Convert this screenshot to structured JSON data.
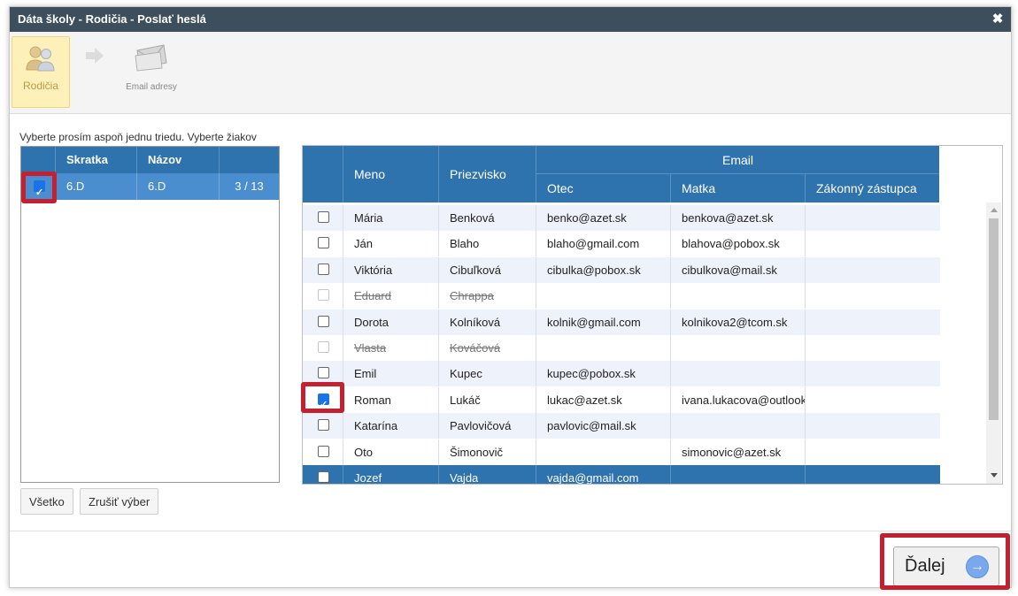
{
  "window": {
    "title": "Dáta školy - Rodičia - Poslať heslá",
    "close_symbol": "✖"
  },
  "wizard": {
    "steps": [
      {
        "label": "Rodičia",
        "icon": "parents-icon",
        "active": true
      },
      {
        "label": "Email adresy",
        "icon": "envelope-icon",
        "active": false
      }
    ],
    "arrow_icon": "arrow-right-icon"
  },
  "instruction": "Vyberte prosím aspoň jednu triedu. Vyberte žiakov",
  "class_grid": {
    "headers": {
      "shortcut": "Skratka",
      "name": "Názov"
    },
    "rows": [
      {
        "checked": true,
        "shortcut": "6.D",
        "name": "6.D",
        "count": "3 / 13"
      }
    ]
  },
  "student_grid": {
    "headers": {
      "first": "Meno",
      "last": "Priezvisko",
      "email_group": "Email",
      "father": "Otec",
      "mother": "Matka",
      "guardian": "Zákonný zástupca"
    },
    "rows": [
      {
        "first": "Mária",
        "last": "Benková",
        "father": "benko@azet.sk",
        "mother": "benkova@azet.sk",
        "guardian": "",
        "checked": false,
        "disabled": false
      },
      {
        "first": "Ján",
        "last": "Blaho",
        "father": "blaho@gmail.com",
        "mother": "blahova@pobox.sk",
        "guardian": "",
        "checked": false,
        "disabled": false
      },
      {
        "first": "Viktória",
        "last": "Cibuľková",
        "father": "cibulka@pobox.sk",
        "mother": "cibulkova@mail.sk",
        "guardian": "",
        "checked": false,
        "disabled": false
      },
      {
        "first": "Eduard",
        "last": "Chrappa",
        "father": "",
        "mother": "",
        "guardian": "",
        "checked": false,
        "disabled": true
      },
      {
        "first": "Dorota",
        "last": "Kolníková",
        "father": "kolnik@gmail.com",
        "mother": "kolnikova2@tcom.sk",
        "guardian": "",
        "checked": false,
        "disabled": false
      },
      {
        "first": "Vlasta",
        "last": "Kováčová",
        "father": "",
        "mother": "",
        "guardian": "",
        "checked": false,
        "disabled": true
      },
      {
        "first": "Emil",
        "last": "Kupec",
        "father": "kupec@pobox.sk",
        "mother": "",
        "guardian": "",
        "checked": false,
        "disabled": false
      },
      {
        "first": "Roman",
        "last": "Lukáč",
        "father": "lukac@azet.sk",
        "mother": "ivana.lukacova@outlook",
        "guardian": "",
        "checked": true,
        "disabled": false
      },
      {
        "first": "Katarína",
        "last": "Pavlovičová",
        "father": "pavlovic@mail.sk",
        "mother": "",
        "guardian": "",
        "checked": false,
        "disabled": false
      },
      {
        "first": "Oto",
        "last": "Šimonovič",
        "father": "",
        "mother": "simonovic@azet.sk",
        "guardian": "",
        "checked": false,
        "disabled": false
      },
      {
        "first": "Jozef",
        "last": "Vajda",
        "father": "vajda@gmail.com",
        "mother": "",
        "guardian": "",
        "checked": false,
        "disabled": false,
        "selected": true
      }
    ]
  },
  "buttons": {
    "select_all": "Všetko",
    "clear_selection": "Zrušiť výber",
    "next": "Ďalej",
    "next_icon": "→"
  },
  "colors": {
    "header_blue": "#2e73ad",
    "row_blue": "#4a8ecf",
    "highlight_red": "#c4202f",
    "title_bar": "#3d4f5d"
  }
}
